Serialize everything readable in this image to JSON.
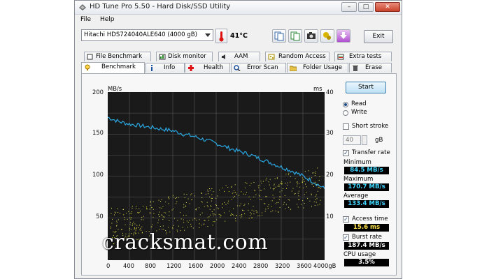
{
  "window": {
    "title": "HD Tune Pro 5.50 - Hard Disk/SSD Utility",
    "controls": {
      "minimize": "–",
      "maximize": "□",
      "close": "✕"
    }
  },
  "menu": [
    "File",
    "Help"
  ],
  "toolbar": {
    "drive": "Hitachi HDS724040ALE640 (4000 gB)",
    "temperature": "41°C",
    "exit_label": "Exit",
    "icons": [
      "copy-icon",
      "copy-all-icon",
      "camera-icon",
      "options-icon",
      "save-icon"
    ]
  },
  "tabs_top": [
    "File Benchmark",
    "Disk monitor",
    "AAM",
    "Random Access",
    "Extra tests"
  ],
  "tabs_bottom": [
    "Benchmark",
    "Info",
    "Health",
    "Error Scan",
    "Folder Usage",
    "Erase"
  ],
  "chart": {
    "left_unit": "MB/s",
    "right_unit": "ms",
    "left_ticks": [
      "200",
      "150",
      "100",
      "50"
    ],
    "right_ticks": [
      "40",
      "30",
      "20",
      "10"
    ],
    "x_ticks": [
      "0",
      "400",
      "800",
      "1200",
      "1600",
      "2000",
      "2400",
      "2800",
      "3200",
      "3600",
      "4000gB"
    ]
  },
  "chart_data": {
    "type": "line",
    "x": [
      0,
      200,
      400,
      600,
      800,
      1000,
      1200,
      1400,
      1600,
      1800,
      2000,
      2200,
      2400,
      2600,
      2800,
      3000,
      3200,
      3400,
      3600,
      3800,
      4000
    ],
    "series": [
      {
        "values": [
          170,
          165,
          162,
          160,
          158,
          156,
          154,
          150,
          147,
          143,
          139,
          134,
          130,
          126,
          121,
          116,
          111,
          106,
          100,
          93,
          85
        ]
      }
    ],
    "ylim": [
      0,
      200
    ],
    "y2lim": [
      0,
      40
    ],
    "xlim": [
      0,
      4000
    ]
  },
  "side": {
    "start_label": "Start",
    "read_label": "Read",
    "write_label": "Write",
    "short_stroke_label": "Short stroke",
    "short_stroke_value": "40",
    "short_stroke_unit": "gB",
    "transfer_rate_label": "Transfer rate",
    "minimum_label": "Minimum",
    "minimum_value": "84.5 MB/s",
    "maximum_label": "Maximum",
    "maximum_value": "170.7 MB/s",
    "average_label": "Average",
    "average_value": "133.4 MB/s",
    "access_time_label": "Access time",
    "access_time_value": "15.6 ms",
    "burst_rate_label": "Burst rate",
    "burst_rate_value": "187.4 MB/s",
    "cpu_usage_label": "CPU usage",
    "cpu_usage_value": "3.5%"
  },
  "watermark": "cracksmat.com",
  "colors": {
    "transfer_line": "#2aa6e0",
    "access_dots": "#e8e84a",
    "plot_bg": "#1a1a1a",
    "grid": "#5a5a5a"
  }
}
